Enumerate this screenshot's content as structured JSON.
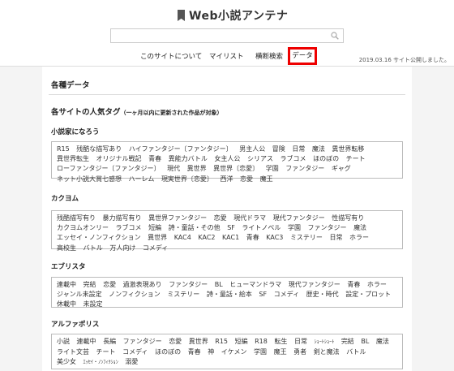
{
  "header": {
    "logo": "Web小説アンテナ",
    "search_placeholder": "",
    "nav": [
      "このサイトについて",
      "マイリスト",
      "横断検索",
      "データ"
    ],
    "update_note": "2019.03.16 サイト公開しました。"
  },
  "main": {
    "section_title": "各種データ",
    "subsection_title": "各サイトの人気タグ",
    "subsection_note": "（一ヶ月以内に更新された作品が対象）",
    "sites": [
      {
        "name": "小説家になろう",
        "tags": [
          "R15",
          "残酷な描写あり",
          "ハイファンタジー〔ファンタジー〕",
          "男主人公",
          "冒険",
          "日常",
          "魔法",
          "異世界転移",
          "異世界転生",
          "オリジナル戦記",
          "青春",
          "異能力バトル",
          "女主人公",
          "シリアス",
          "ラブコメ",
          "ほのぼの",
          "チート",
          "ローファンタジー〔ファンタジー〕",
          "現代",
          "異世界",
          "異世界〔恋愛〕",
          "学園",
          "ファンタジー",
          "ギャグ",
          "ネット小説大賞七感想",
          "ハーレム",
          "現実世界〔恋愛〕",
          "西洋",
          "恋愛",
          "魔王"
        ]
      },
      {
        "name": "カクヨム",
        "tags": [
          "残酷描写有り",
          "暴力描写有り",
          "異世界ファンタジー",
          "恋愛",
          "現代ドラマ",
          "現代ファンタジー",
          "性描写有り",
          "カクヨムオンリー",
          "ラブコメ",
          "短編",
          "詩・童話・その他",
          "SF",
          "ライトノベル",
          "学園",
          "ファンタジー",
          "魔法",
          "エッセイ・ノンフィクション",
          "異世界",
          "KAC4",
          "KAC2",
          "KAC1",
          "青春",
          "KAC3",
          "ミステリー",
          "日常",
          "ホラー",
          "高校生",
          "バトル",
          "万人向け",
          "コメディ"
        ]
      },
      {
        "name": "エブリスタ",
        "tags": [
          "連載中",
          "完結",
          "恋愛",
          "過激表現あり",
          "ファンタジー",
          "BL",
          "ヒューマンドラマ",
          "現代ファンタジー",
          "青春",
          "ホラー",
          "ジャンル未設定",
          "ノンフィクション",
          "ミステリー",
          "詩・童話・絵本",
          "SF",
          "コメディ",
          "歴史・時代",
          "設定・プロット",
          "休載中",
          "未設定"
        ]
      },
      {
        "name": "アルファポリス",
        "tags": [
          "小説",
          "連載中",
          "長編",
          "ファンタジー",
          "恋愛",
          "異世界",
          "R15",
          "短編",
          "R18",
          "転生",
          "日常",
          "ｼｮｰﾄｼｮｰﾄ",
          "完結",
          "BL",
          "魔法",
          "ライト文芸",
          "チート",
          "コメディ",
          "ほのぼの",
          "青春",
          "神",
          "イケメン",
          "学園",
          "魔王",
          "勇者",
          "剣と魔法",
          "バトル",
          "美少女",
          "ｴｯｾｲ・ﾉﾝﾌｨｸｼｮﾝ",
          "溺愛"
        ]
      }
    ]
  }
}
